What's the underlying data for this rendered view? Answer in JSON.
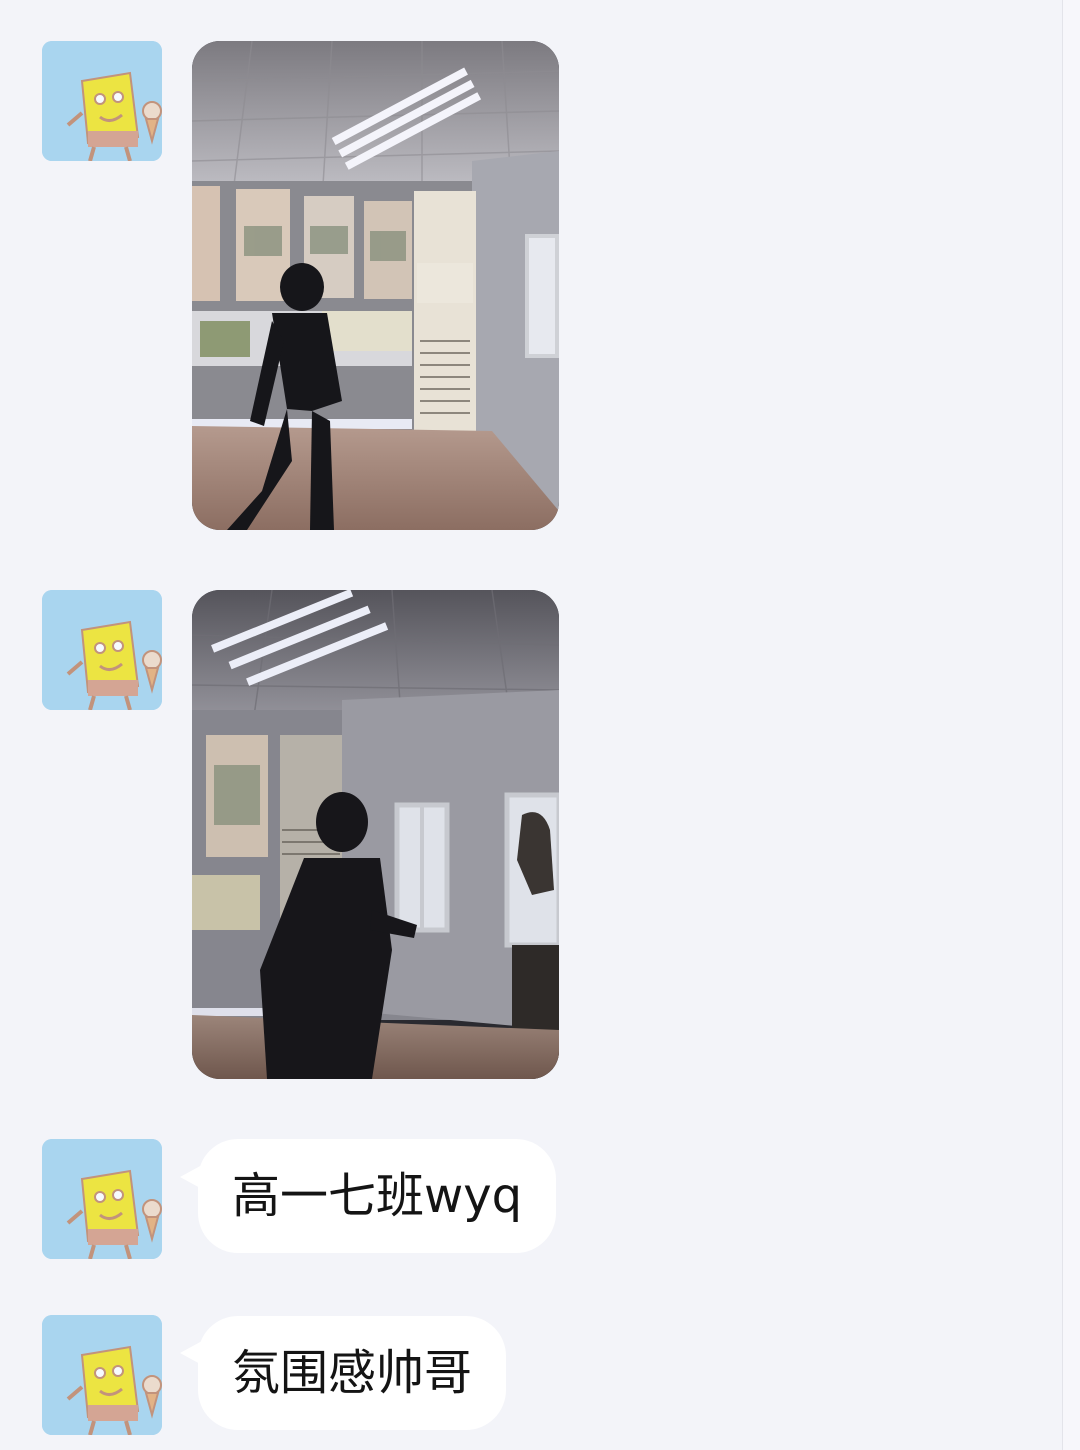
{
  "colors": {
    "background": "#f3f4f9",
    "bubble": "#ffffff",
    "text": "#141414",
    "avatar_tile": "#a9d5ef",
    "avatar_character": "#f3e62f"
  },
  "messages": [
    {
      "type": "image",
      "sender_avatar_icon": "sponge-cartoon-avatar-icon",
      "content": "photo"
    },
    {
      "type": "image",
      "sender_avatar_icon": "sponge-cartoon-avatar-icon",
      "content": "photo"
    },
    {
      "type": "text",
      "sender_avatar_icon": "sponge-cartoon-avatar-icon",
      "text": "高一七班wyq"
    },
    {
      "type": "text",
      "sender_avatar_icon": "sponge-cartoon-avatar-icon",
      "text": "氛围感帅哥"
    }
  ]
}
